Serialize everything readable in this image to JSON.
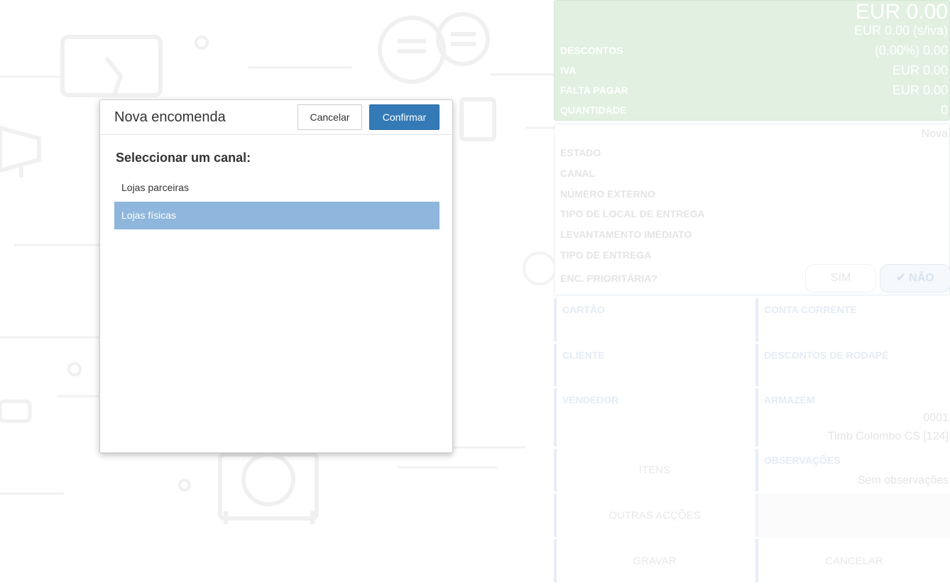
{
  "colors": {
    "primary_button": "#337ab7",
    "selected_row": "#8fb6dc",
    "totals_background": "#e1f0e1"
  },
  "modal": {
    "title": "Nova encomenda",
    "cancel_label": "Cancelar",
    "confirm_label": "Confirmar",
    "prompt": "Seleccionar um canal:",
    "channels": [
      {
        "label": "Lojas parceiras",
        "selected": false
      },
      {
        "label": "Lojas físicas",
        "selected": true
      }
    ]
  },
  "totals": {
    "total": "EUR 0.00",
    "total_no_vat": "EUR 0.00 (s/iva)",
    "rows": [
      {
        "label": "DESCONTOS",
        "value": "(0.00%) 0.00"
      },
      {
        "label": "IVA",
        "value": "EUR 0.00"
      },
      {
        "label": "FALTA PAGAR",
        "value": "EUR 0.00"
      },
      {
        "label": "QUANTIDADE",
        "value": "0"
      }
    ]
  },
  "details": {
    "state_value": "Nova",
    "labels": [
      "ESTADO",
      "CANAL",
      "NÚMERO EXTERNO",
      "TIPO DE LOCAL DE ENTREGA",
      "LEVANTAMENTO IMEDIATO",
      "TIPO DE ENTREGA"
    ],
    "priority_label": "ENC. PRIORITÁRIA?",
    "priority_yes": "SIM",
    "priority_no": "✔ NÃO"
  },
  "tiles": {
    "card": "CARTÃO",
    "current_account": "CONTA CORRENTE",
    "client": "CLIENTE",
    "footer_discounts": "DESCONTOS DE RODAPÉ",
    "seller": "VENDEDOR",
    "warehouse": "ARMAZÉM",
    "warehouse_code": "0001",
    "warehouse_name": "Timb Colombo CS [124]",
    "items": "ITENS",
    "notes": "OBSERVAÇÕES",
    "notes_value": "Sem observações",
    "other_actions": "OUTRAS ACÇÕES",
    "save": "GRAVAR",
    "cancel": "CANCELAR"
  },
  "icons": [
    "wallet-icon",
    "chat-bubbles-icon",
    "megaphone-icon",
    "camera-icon",
    "gear-icon",
    "shield-icon"
  ]
}
